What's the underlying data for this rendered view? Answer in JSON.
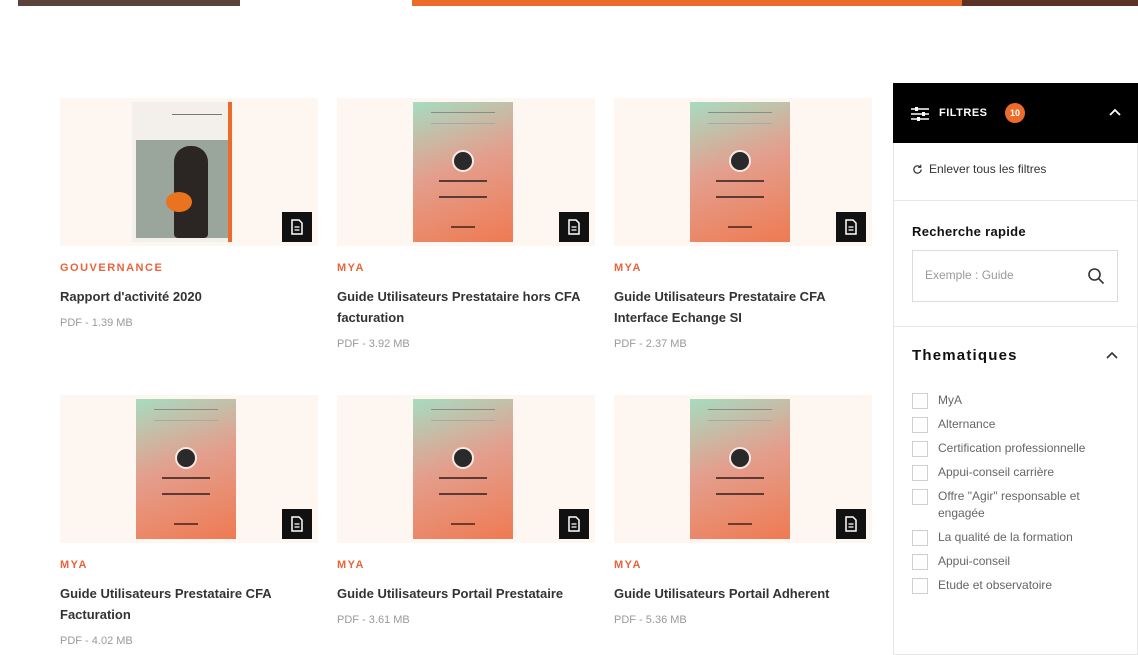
{
  "colors": {
    "accent": "#ec6b2a",
    "category_text": "#e8643a",
    "header_bg": "#000000",
    "title_text": "#333333",
    "meta_text": "#9a9a9a"
  },
  "documents": [
    {
      "category": "GOUVERNANCE",
      "title": "Rapport d'activité 2020",
      "meta": "PDF - 1.39 MB",
      "cover": "photo",
      "icon": "pdf-file-icon"
    },
    {
      "category": "MYA",
      "title": "Guide Utilisateurs Prestataire hors CFA facturation",
      "meta": "PDF - 3.92 MB",
      "cover": "gradient",
      "icon": "pdf-file-icon"
    },
    {
      "category": "MYA",
      "title": "Guide Utilisateurs Prestataire CFA Interface Echange SI",
      "meta": "PDF - 2.37 MB",
      "cover": "gradient",
      "icon": "pdf-file-icon"
    },
    {
      "category": "MYA",
      "title": "Guide Utilisateurs Prestataire CFA Facturation",
      "meta": "PDF - 4.02 MB",
      "cover": "gradient",
      "icon": "pdf-file-icon"
    },
    {
      "category": "MYA",
      "title": "Guide Utilisateurs Portail Prestataire",
      "meta": "PDF - 3.61 MB",
      "cover": "gradient",
      "icon": "pdf-file-icon"
    },
    {
      "category": "MYA",
      "title": "Guide Utilisateurs Portail Adherent",
      "meta": "PDF - 5.36 MB",
      "cover": "gradient",
      "icon": "pdf-file-icon"
    }
  ],
  "sidebar": {
    "header_label": "FILTRES",
    "filter_count": "10",
    "clear_label": "Enlever tous les filtres",
    "quick_search": {
      "title": "Recherche rapide",
      "placeholder": "Exemple : Guide"
    },
    "thematiques": {
      "title": "Thematiques",
      "items": [
        "MyA",
        "Alternance",
        "Certification professionnelle",
        "Appui-conseil carrière",
        "Offre \"Agir\" responsable et engagée",
        "La qualité de la formation",
        "Appui-conseil",
        "Etude et observatoire"
      ]
    }
  }
}
